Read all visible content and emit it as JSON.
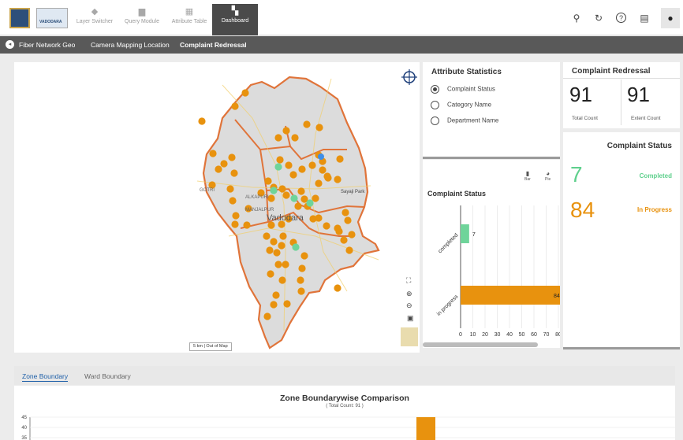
{
  "nav": {
    "items": [
      {
        "label": "Layer Switcher",
        "icon": "layers-icon"
      },
      {
        "label": "Query Module",
        "icon": "chat-icon"
      },
      {
        "label": "Attribute Table",
        "icon": "table-icon"
      },
      {
        "label": "Dashboard",
        "icon": "dashboard-icon"
      }
    ],
    "logo_text": "VADODARA"
  },
  "breadcrumb": {
    "items": [
      "Fiber Network Geo",
      "Camera Mapping Location",
      "Complaint Redressal"
    ]
  },
  "map": {
    "city_label": "Vadodara",
    "place_labels": [
      "GOTRI",
      "ALKAPURI",
      "MANJALPUR",
      "Sayaji Park"
    ],
    "scale_label": "5 km",
    "out_of_map_label": "Out of Map",
    "points_inprogress": [
      [
        256,
        154
      ],
      [
        311,
        118
      ],
      [
        363,
        166
      ],
      [
        389,
        158
      ],
      [
        405,
        162
      ],
      [
        298,
        135
      ],
      [
        270,
        195
      ],
      [
        294,
        200
      ],
      [
        277,
        215
      ],
      [
        284,
        208
      ],
      [
        297,
        220
      ],
      [
        269,
        235
      ],
      [
        292,
        240
      ],
      [
        295,
        255
      ],
      [
        299,
        274
      ],
      [
        298,
        285
      ],
      [
        313,
        286
      ],
      [
        315,
        265
      ],
      [
        340,
        230
      ],
      [
        347,
        238
      ],
      [
        358,
        240
      ],
      [
        344,
        252
      ],
      [
        363,
        248
      ],
      [
        355,
        203
      ],
      [
        366,
        210
      ],
      [
        372,
        222
      ],
      [
        383,
        215
      ],
      [
        396,
        210
      ],
      [
        409,
        216
      ],
      [
        416,
        226
      ],
      [
        428,
        228
      ],
      [
        431,
        202
      ],
      [
        404,
        233
      ],
      [
        400,
        252
      ],
      [
        382,
        243
      ],
      [
        386,
        253
      ],
      [
        378,
        262
      ],
      [
        390,
        262
      ],
      [
        397,
        278
      ],
      [
        404,
        277
      ],
      [
        414,
        287
      ],
      [
        428,
        290
      ],
      [
        438,
        270
      ],
      [
        441,
        280
      ],
      [
        446,
        298
      ],
      [
        436,
        305
      ],
      [
        443,
        318
      ],
      [
        430,
        294
      ],
      [
        366,
        278
      ],
      [
        357,
        285
      ],
      [
        344,
        286
      ],
      [
        338,
        300
      ],
      [
        347,
        307
      ],
      [
        342,
        318
      ],
      [
        351,
        321
      ],
      [
        357,
        312
      ],
      [
        359,
        300
      ],
      [
        353,
        336
      ],
      [
        343,
        348
      ],
      [
        362,
        336
      ],
      [
        383,
        341
      ],
      [
        386,
        325
      ],
      [
        372,
        308
      ],
      [
        381,
        356
      ],
      [
        358,
        356
      ],
      [
        350,
        375
      ],
      [
        347,
        387
      ],
      [
        339,
        402
      ],
      [
        364,
        386
      ],
      [
        382,
        370
      ],
      [
        428,
        366
      ],
      [
        415,
        224
      ],
      [
        353,
        175
      ],
      [
        374,
        175
      ],
      [
        404,
        197
      ],
      [
        409,
        205
      ],
      [
        331,
        245
      ]
    ],
    "points_completed": [
      [
        353,
        212
      ],
      [
        373,
        252
      ],
      [
        393,
        258
      ],
      [
        375,
        314
      ],
      [
        347,
        242
      ]
    ],
    "colors": {
      "inprogress": "#e8920e",
      "completed": "#6fd49a"
    }
  },
  "attribute_statistics": {
    "title": "Attribute Statistics",
    "options": [
      {
        "label": "Complaint Status",
        "selected": true
      },
      {
        "label": "Category Name",
        "selected": false
      },
      {
        "label": "Department Name",
        "selected": false
      }
    ]
  },
  "complaint_chart": {
    "title": "Complaint Status",
    "bar_label": "Bar",
    "pie_label": "Pie"
  },
  "chart_data": [
    {
      "type": "bar",
      "orientation": "horizontal",
      "title": "Complaint Status",
      "categories": [
        "completed",
        "in progress"
      ],
      "values": [
        7,
        84
      ],
      "xlim": [
        0,
        80
      ],
      "x_ticks": [
        0,
        10,
        20,
        30,
        40,
        50,
        60,
        70,
        80
      ],
      "colors": [
        "#6fd49a",
        "#e8920e"
      ]
    },
    {
      "type": "bar",
      "title": "Zone Boundarywise Comparison",
      "subtitle": "( Total Count: 91 )",
      "y_ticks": [
        45,
        40,
        35
      ],
      "values": [
        45
      ],
      "color": "#e8920e"
    }
  ],
  "complaint_redressal": {
    "title": "Complaint Redressal",
    "total_count": "91",
    "total_label": "Total Count",
    "extent_count": "91",
    "extent_label": "Extent Count"
  },
  "complaint_status_panel": {
    "title": "Complaint Status",
    "completed_value": "7",
    "completed_label": "Completed",
    "inprogress_value": "84",
    "inprogress_label": "In Progress",
    "completed_color": "#5fd08d",
    "inprogress_color": "#e8920e"
  },
  "bottom": {
    "tabs": [
      "Zone Boundary",
      "Ward Boundary"
    ],
    "active_tab": 0,
    "chart_title": "Zone Boundarywise Comparison",
    "chart_subtitle": "( Total Count: 91 )"
  }
}
